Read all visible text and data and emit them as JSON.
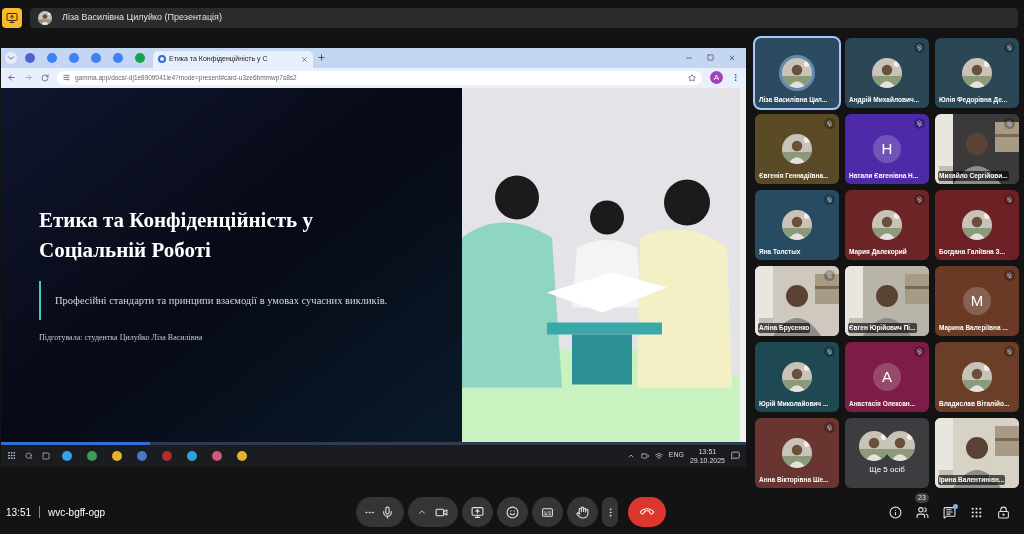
{
  "presenter_bar": {
    "label": "Ліза Василівна Цилуйко (Презентація)"
  },
  "browser": {
    "tabs": [
      {
        "title": "Етика та Конфіденційність у С",
        "selected": true
      }
    ],
    "address": "gamma.app/docs/-dj1e890tf041ie4?mode=present#card-u3ze6bmmwp7s8s2",
    "profile_letter": "А"
  },
  "slide_progress": {
    "level": 0.2
  },
  "slide": {
    "title": "Етика та Конфіденційність у Соціальній Роботі",
    "subtitle": "Професійні стандарти та принципи взаємодії в умовах сучасних викликів.",
    "author": "Підготувала: студентка Цилуйко Ліза Василівна"
  },
  "taskbar": {
    "language": "ENG",
    "time": "13:51",
    "date": "29.10.2025"
  },
  "participants": [
    {
      "name": "Ліза Василівна Цил...",
      "muted": false,
      "speaking": true,
      "color": "#2c4a60"
    },
    {
      "name": "Андрій Михайлович...",
      "muted": true,
      "speaking": false,
      "color": "#2b4756"
    },
    {
      "name": "Юлія Федорівна Де...",
      "muted": true,
      "speaking": false,
      "color": "#2b4756"
    },
    {
      "name": "Євгенія Геннадіївна...",
      "muted": true,
      "speaking": false,
      "color": "#5a4a26"
    },
    {
      "kind": "letter",
      "letter": "Н",
      "name": "Натали Євгенівна Н...",
      "muted": true,
      "speaking": false,
      "color": "#4f2aa8"
    },
    {
      "kind": "video",
      "name": "Михайло Сергійови...",
      "muted": true,
      "speaking": false,
      "color": "#3a3a3a"
    },
    {
      "name": "Яна Толстых",
      "muted": true,
      "speaking": false,
      "color": "#274b60"
    },
    {
      "name": "Мария Далекорий",
      "muted": true,
      "speaking": false,
      "color": "#6e2528"
    },
    {
      "name": "Богдана Галіївна З...",
      "muted": true,
      "speaking": false,
      "color": "#6e2124"
    },
    {
      "kind": "video",
      "name": "Аліна Брусенко",
      "muted": true,
      "speaking": false,
      "color": "#cfc8bf"
    },
    {
      "kind": "video",
      "name": "Євген Юрійович Пі...",
      "muted": false,
      "speaking": false,
      "color": "#b9b4aa"
    },
    {
      "kind": "letter",
      "letter": "M",
      "name": "Марина Валеріївна ...",
      "muted": true,
      "speaking": false,
      "color": "#6a3a26"
    },
    {
      "name": "Юрій Миколайович ...",
      "muted": true,
      "speaking": false,
      "color": "#1e4852"
    },
    {
      "kind": "letter",
      "letter": "A",
      "name": "Анастасія Олексан...",
      "muted": true,
      "speaking": false,
      "color": "#7e1c48"
    },
    {
      "name": "Владислав Віталійо...",
      "muted": true,
      "speaking": false,
      "color": "#6a3e28"
    },
    {
      "name": "Анна Вікторівна Ше...",
      "muted": true,
      "speaking": false,
      "color": "#6a3530"
    },
    {
      "kind": "more",
      "name": "Ще 5 осіб",
      "muted": false,
      "speaking": false,
      "color": "#3c3d40"
    },
    {
      "kind": "video",
      "name": "Ірина Валентинівн...",
      "muted": false,
      "speaking": false,
      "color": "#d8d2c6"
    }
  ],
  "meeting": {
    "time": "13:51",
    "code": "wvc-bgff-ogp",
    "people_count": "23",
    "chat_unread": true
  }
}
